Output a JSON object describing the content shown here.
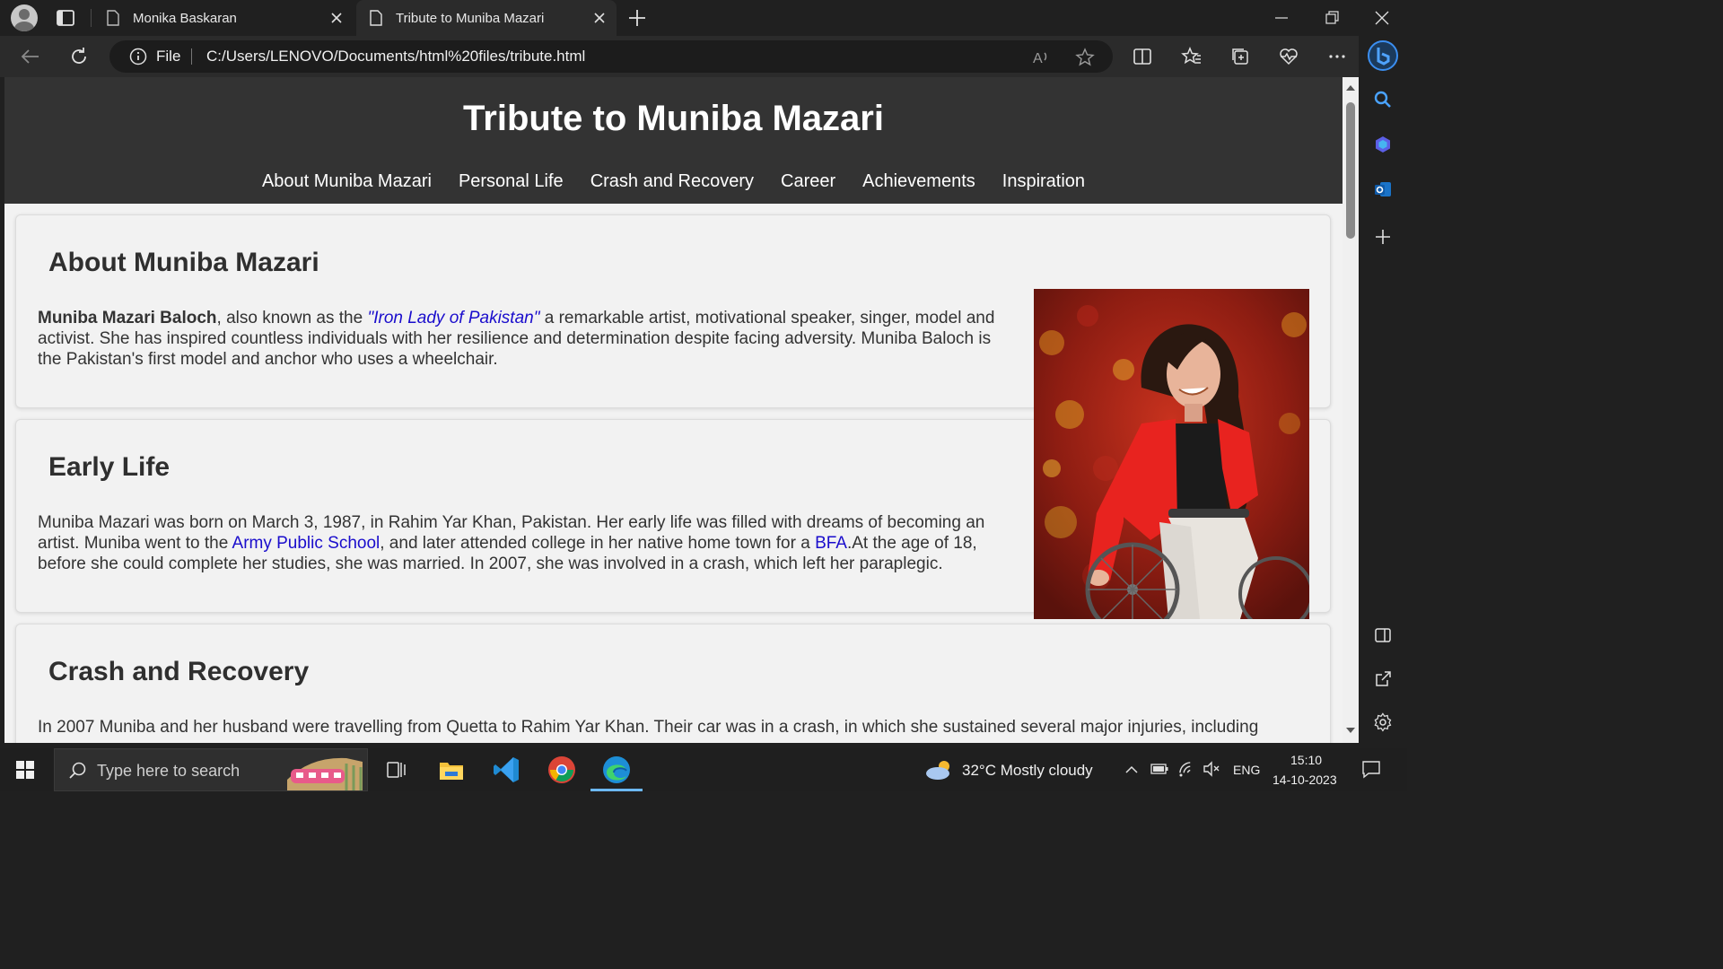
{
  "browser": {
    "tabs": [
      {
        "label": "Monika Baskaran",
        "active": false
      },
      {
        "label": "Tribute to Muniba Mazari",
        "active": true
      }
    ],
    "address": {
      "scheme_label": "File",
      "url": "C:/Users/LENOVO/Documents/html%20files/tribute.html"
    }
  },
  "page": {
    "title": "Tribute to Muniba Mazari",
    "nav": [
      "About Muniba Mazari",
      "Personal Life",
      "Crash and Recovery",
      "Career",
      "Achievements",
      "Inspiration"
    ],
    "sections": {
      "about": {
        "heading": "About Muniba Mazari",
        "name": "Muniba Mazari Baloch",
        "t1": ", also known as the ",
        "nickname": "\"Iron Lady of Pakistan\"",
        "t2": " a remarkable artist, motivational speaker, singer, model and activist. She has inspired countless individuals with her resilience and determination despite facing adversity. Muniba Baloch is the Pakistan's first model and anchor who uses a wheelchair."
      },
      "early": {
        "heading": "Early Life",
        "t1": "Muniba Mazari was born on March 3, 1987, in Rahim Yar Khan, Pakistan. Her early life was filled with dreams of becoming an artist. Muniba went to the ",
        "link1": "Army Public School",
        "t2": ", and later attended college in her native home town for a ",
        "link2": "BFA",
        "t3": ".At the age of 18, before she could complete her studies, she was married. In 2007, she was involved in a crash, which left her paraplegic."
      },
      "crash": {
        "heading": "Crash and Recovery",
        "t1": "In 2007 Muniba and her husband were travelling from Quetta to Rahim Yar Khan. Their car was in a crash, in which she sustained several major injuries, including"
      }
    }
  },
  "taskbar": {
    "search_placeholder": "Type here to search",
    "weather": "32°C  Mostly cloudy",
    "lang": "ENG",
    "time": "15:10",
    "date": "14-10-2023"
  },
  "colors": {
    "header_bg": "#333333",
    "link": "#1a0dcc",
    "page_bg": "#f2f2f2",
    "jacket_red": "#e8231f"
  }
}
